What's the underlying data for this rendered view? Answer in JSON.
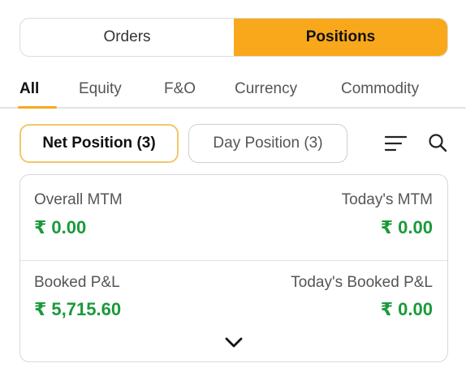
{
  "segment": {
    "orders_label": "Orders",
    "positions_label": "Positions",
    "selected": "Positions"
  },
  "tabs": [
    {
      "label": "All",
      "active": true
    },
    {
      "label": "Equity",
      "active": false
    },
    {
      "label": "F&O",
      "active": false
    },
    {
      "label": "Currency",
      "active": false
    },
    {
      "label": "Commodity",
      "active": false
    }
  ],
  "filters": {
    "net_position": "Net Position (3)",
    "day_position": "Day Position (3)",
    "selected": "Net Position (3)"
  },
  "icons": {
    "sort": "sort-lines-icon",
    "search": "search-icon",
    "expand": "chevron-down-icon"
  },
  "summary": {
    "overall_mtm_label": "Overall MTM",
    "overall_mtm_value": "₹ 0.00",
    "todays_mtm_label": "Today's MTM",
    "todays_mtm_value": "₹ 0.00",
    "booked_pl_label": "Booked P&L",
    "booked_pl_value": "₹ 5,715.60",
    "todays_booked_pl_label": "Today's Booked P&L",
    "todays_booked_pl_value": "₹ 0.00"
  },
  "colors": {
    "accent": "#f9a81c",
    "profit_green": "#1a9a3a"
  }
}
